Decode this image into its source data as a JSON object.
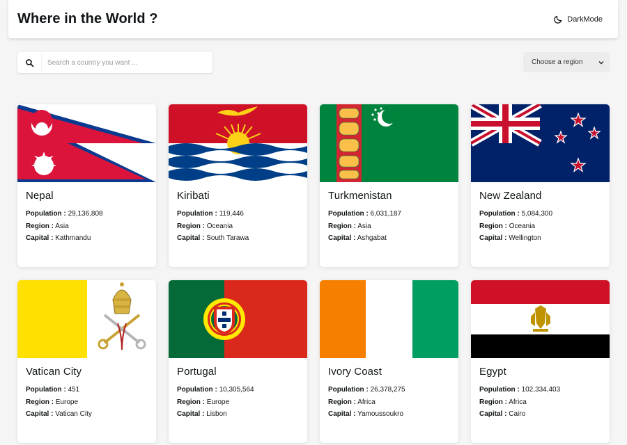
{
  "header": {
    "title": "Where in the World ?",
    "darkmode_label": "DarkMode"
  },
  "search": {
    "placeholder": "Search a country you want ...",
    "value": ""
  },
  "region_select": {
    "selected": "Choose a region"
  },
  "labels": {
    "population": "Population :",
    "region": "Region :",
    "capital": "Capital :"
  },
  "countries": [
    {
      "name": "Nepal",
      "population": "29,136,808",
      "region": "Asia",
      "capital": "Kathmandu"
    },
    {
      "name": "Kiribati",
      "population": "119,446",
      "region": "Oceania",
      "capital": "South Tarawa"
    },
    {
      "name": "Turkmenistan",
      "population": "6,031,187",
      "region": "Asia",
      "capital": "Ashgabat"
    },
    {
      "name": "New Zealand",
      "population": "5,084,300",
      "region": "Oceania",
      "capital": "Wellington"
    },
    {
      "name": "Vatican City",
      "population": "451",
      "region": "Europe",
      "capital": "Vatican City"
    },
    {
      "name": "Portugal",
      "population": "10,305,564",
      "region": "Europe",
      "capital": "Lisbon"
    },
    {
      "name": "Ivory Coast",
      "population": "26,378,275",
      "region": "Africa",
      "capital": "Yamoussoukro"
    },
    {
      "name": "Egypt",
      "population": "102,334,403",
      "region": "Africa",
      "capital": "Cairo"
    }
  ],
  "icons": {
    "darkmode": "moon-icon",
    "search": "search-icon",
    "select": "chevron-down-icon"
  }
}
